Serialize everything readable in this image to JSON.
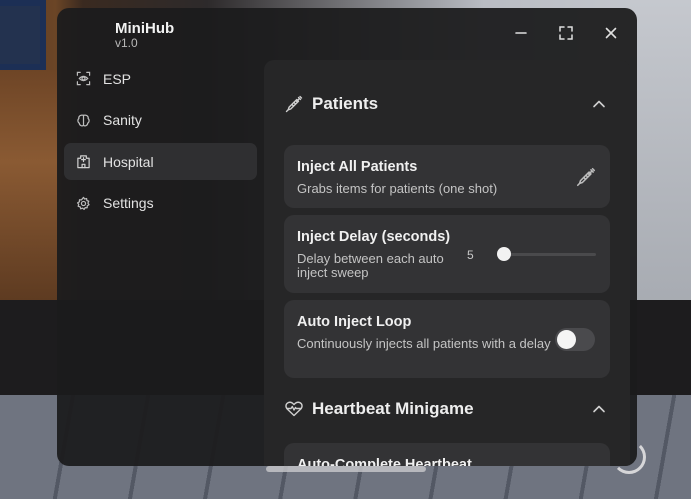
{
  "app": {
    "title": "MiniHub",
    "version": "v1.0"
  },
  "window_controls": {
    "minimize_icon": "minimize-icon",
    "maximize_icon": "maximize-icon",
    "close_icon": "close-icon"
  },
  "sidebar": {
    "items": [
      {
        "label": "ESP",
        "icon": "eye-target-icon",
        "active": false
      },
      {
        "label": "Sanity",
        "icon": "brain-icon",
        "active": false
      },
      {
        "label": "Hospital",
        "icon": "hospital-icon",
        "active": true
      },
      {
        "label": "Settings",
        "icon": "gear-icon",
        "active": false
      }
    ]
  },
  "sections": [
    {
      "title": "Patients",
      "icon": "syringe-icon",
      "expanded": true,
      "cards": [
        {
          "title": "Inject All Patients",
          "description": "Grabs items for patients (one shot)",
          "type": "button",
          "icon": "syringe-icon"
        },
        {
          "title": "Inject Delay (seconds)",
          "description": "Delay between each auto inject sweep",
          "type": "slider",
          "value": "5",
          "fraction": 0.0
        },
        {
          "title": "Auto Inject Loop",
          "description": "Continuously injects all patients with a delay",
          "type": "toggle",
          "enabled": false
        }
      ]
    },
    {
      "title": "Heartbeat Minigame",
      "icon": "heart-pulse-icon",
      "expanded": true,
      "cards": [
        {
          "title": "Auto-Complete Heartbeat",
          "type": "toggle"
        }
      ]
    }
  ],
  "colors": {
    "window_bg": "#1c1c1d",
    "content_bg": "#262627",
    "card_bg": "#333335",
    "active_nav": "#2f2f31",
    "toggle_off": "#4a4a4d"
  }
}
